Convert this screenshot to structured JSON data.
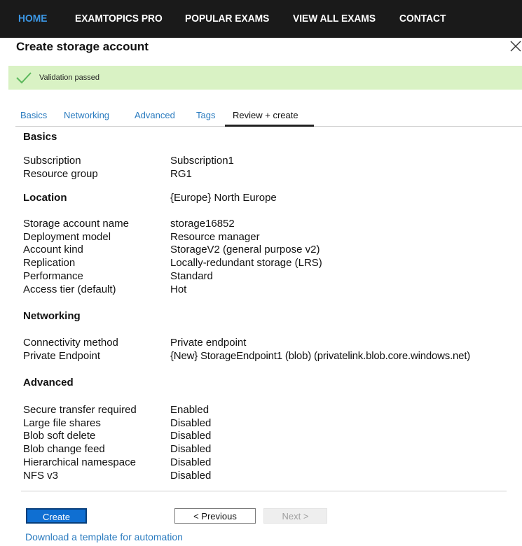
{
  "topnav": {
    "items": [
      {
        "label": "HOME",
        "active": true
      },
      {
        "label": "EXAMTOPICS PRO"
      },
      {
        "label": "POPULAR EXAMS"
      },
      {
        "label": "VIEW ALL EXAMS"
      },
      {
        "label": "CONTACT"
      }
    ]
  },
  "blade": {
    "title": "Create storage account",
    "close_icon": "close-icon"
  },
  "validation": {
    "text": "Validation passed",
    "icon": "check-icon",
    "color": "#d9f2c4"
  },
  "tabs": [
    "Basics",
    "Networking",
    "Advanced",
    "Tags",
    "Review + create"
  ],
  "sections": {
    "basics": {
      "heading": "Basics",
      "rows": [
        {
          "label": "Subscription",
          "value": "Subscription1"
        },
        {
          "label": "Resource group",
          "value": "RG1"
        }
      ]
    },
    "location": {
      "heading": "Location",
      "value": "{Europe} North Europe",
      "rows": [
        {
          "label": "Storage account name",
          "value": "storage16852"
        },
        {
          "label": "Deployment model",
          "value": "Resource manager"
        },
        {
          "label": "Account kind",
          "value": "StorageV2 (general purpose v2)"
        },
        {
          "label": "Replication",
          "value": "Locally-redundant storage (LRS)"
        },
        {
          "label": "Performance",
          "value": "Standard"
        },
        {
          "label": "Access tier (default)",
          "value": "Hot"
        }
      ]
    },
    "networking": {
      "heading": "Networking",
      "rows": [
        {
          "label": "Connectivity method",
          "value": "Private endpoint"
        },
        {
          "label": "Private Endpoint",
          "value": "{New} StorageEndpoint1 (blob) (privatelink.blob.core.windows.net)"
        }
      ]
    },
    "advanced": {
      "heading": "Advanced",
      "rows": [
        {
          "label": "Secure transfer required",
          "value": "Enabled"
        },
        {
          "label": "Large file shares",
          "value": "Disabled"
        },
        {
          "label": "Blob soft delete",
          "value": "Disabled"
        },
        {
          "label": "Blob change feed",
          "value": "Disabled"
        },
        {
          "label": "Hierarchical namespace",
          "value": "Disabled"
        },
        {
          "label": "NFS v3",
          "value": "Disabled"
        }
      ]
    }
  },
  "footer": {
    "create_label": "Create",
    "previous_label": "< Previous",
    "next_label": "Next >",
    "download_link": "Download a template for automation"
  },
  "colors": {
    "nav_bg": "#1a1a1a",
    "nav_active": "#3c97e4",
    "link": "#2a7bbf",
    "primary": "#0f6fd2"
  }
}
